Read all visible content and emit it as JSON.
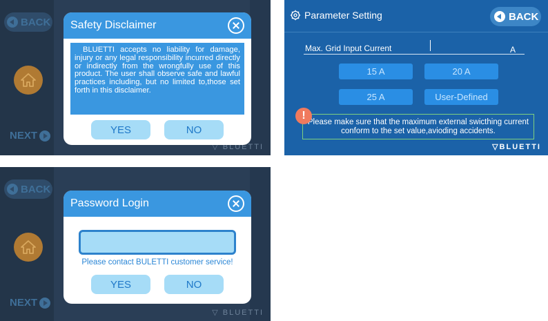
{
  "disclaimer_screen": {
    "back_label": "BACK",
    "next_label": "NEXT",
    "brand": "BLUETTI",
    "dialog": {
      "title": "Safety Disclaimer",
      "body": "BLUETTI accepts no liability for damage, injury or any legal responsibility incurred directly or indirectly from the wrongfully use of this product. The user shall observe safe and lawful practices including, but no limited to,those set forth in this disclaimer.",
      "yes_label": "YES",
      "no_label": "NO"
    }
  },
  "parameter_screen": {
    "title": "Parameter Setting",
    "back_label": "BACK",
    "field_label": "Max. Grid Input Current",
    "field_unit": "A",
    "options": [
      "15 A",
      "20 A",
      "25 A",
      "User-Defined"
    ],
    "warning": "Please make sure that the  maximum external swicthing current conform to the set value,avioding accidents.",
    "warning_icon": "!",
    "brand": "BLUETTI"
  },
  "password_screen": {
    "back_label": "BACK",
    "next_label": "NEXT",
    "brand": "BLUETTI",
    "dialog": {
      "title": "Password Login",
      "hint": "Please contact BULETTI customer service!",
      "yes_label": "YES",
      "no_label": "NO"
    }
  },
  "colors": {
    "dialog_blue": "#3a97e0",
    "button_light_blue": "#a6dcf7",
    "param_background": "#1b62a8",
    "home_dim_background": "#2a3e56"
  }
}
